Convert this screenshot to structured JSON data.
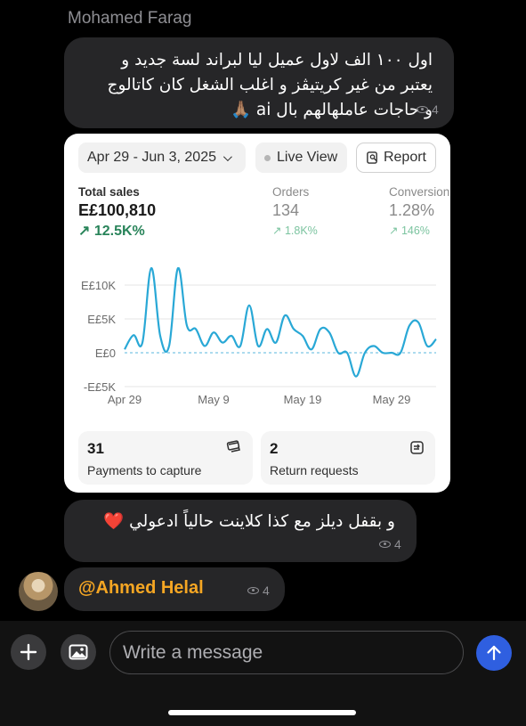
{
  "sender": "Mohamed Farag",
  "message1": {
    "lines": [
      "اول ١٠٠ الف لاول عميل ليا لبراند لسة جديد و",
      "يعتبر من غير كريتيڤز و اغلب الشغل كان كاتالوج",
      "و حاجات عاملهالهم بال ai 🙏🏽"
    ],
    "views": "4"
  },
  "analytics": {
    "date_range": "Apr 29 - Jun 3, 2025",
    "live_view": "Live View",
    "report": "Report",
    "metrics": [
      {
        "label": "Total sales",
        "value": "E£100,810",
        "change": "↗ 12.5K%"
      },
      {
        "label": "Orders",
        "value": "134",
        "change": "↗ 1.8K%"
      },
      {
        "label": "Conversion",
        "value": "1.28%",
        "change": "↗ 146%"
      }
    ],
    "tiles": [
      {
        "count": "31",
        "label": "Payments to capture",
        "icon": "credit-card-icon"
      },
      {
        "count": "2",
        "label": "Return requests",
        "icon": "return-box-icon"
      }
    ]
  },
  "chart_data": {
    "type": "line",
    "title": "",
    "xlabel": "",
    "ylabel": "",
    "y_tick_labels": [
      "E£10K",
      "E£5K",
      "E£0",
      "-E£5K"
    ],
    "y_ticks": [
      10000,
      5000,
      0,
      -5000
    ],
    "x_tick_labels": [
      "Apr 29",
      "May 9",
      "May 19",
      "May 29"
    ],
    "ylim": [
      -5000,
      12500
    ],
    "grid": true,
    "color": "#29a8d6",
    "x": [
      "Apr 29",
      "Apr 30",
      "May 1",
      "May 2",
      "May 3",
      "May 4",
      "May 5",
      "May 6",
      "May 7",
      "May 8",
      "May 9",
      "May 10",
      "May 11",
      "May 12",
      "May 13",
      "May 14",
      "May 15",
      "May 16",
      "May 17",
      "May 18",
      "May 19",
      "May 20",
      "May 21",
      "May 22",
      "May 23",
      "May 24",
      "May 25",
      "May 26",
      "May 27",
      "May 28",
      "May 29",
      "May 30",
      "May 31",
      "Jun 1",
      "Jun 2",
      "Jun 3"
    ],
    "values": [
      500,
      2600,
      1500,
      12500,
      2500,
      1000,
      12500,
      4000,
      3500,
      1000,
      3000,
      1500,
      2500,
      1000,
      7000,
      1000,
      3500,
      1500,
      5500,
      3500,
      2500,
      500,
      3500,
      3000,
      0,
      0,
      -3500,
      0,
      1000,
      0,
      0,
      0,
      4000,
      4500,
      1000,
      2000
    ]
  },
  "message2": {
    "text": "و بقفل ديلز مع كذا كلاينت حالياً ادعولي ❤️",
    "views": "4"
  },
  "message3": {
    "mention": "@Ahmed Helal",
    "views": "4"
  },
  "composer": {
    "placeholder": "Write a message"
  },
  "colors": {
    "accent": "#2f5fe0",
    "mention": "#f5a623",
    "positive": "#29845a",
    "line": "#29a8d6"
  }
}
